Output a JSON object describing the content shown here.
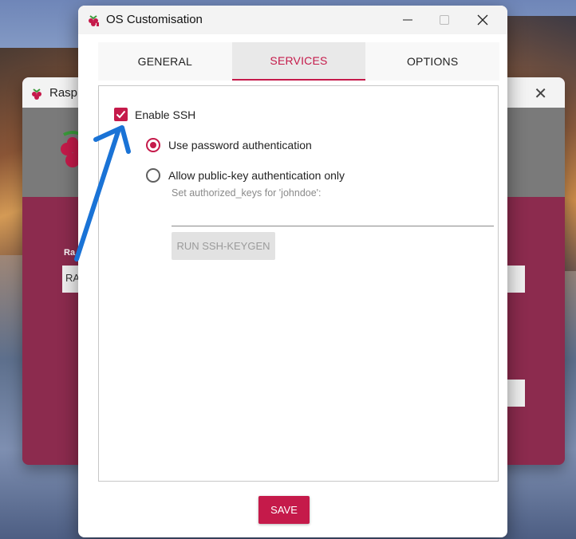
{
  "background_window": {
    "title": "Raspb",
    "field_text": "RA",
    "label_text": "Ra"
  },
  "dialog": {
    "title": "OS Customisation",
    "tabs": [
      {
        "label": "GENERAL",
        "active": false
      },
      {
        "label": "SERVICES",
        "active": true
      },
      {
        "label": "OPTIONS",
        "active": false
      }
    ],
    "services": {
      "enable_ssh_label": "Enable SSH",
      "enable_ssh_checked": true,
      "auth_options": [
        {
          "label": "Use password authentication",
          "selected": true
        },
        {
          "label": "Allow public-key authentication only",
          "selected": false
        }
      ],
      "authorized_keys_label": "Set authorized_keys for 'johndoe':",
      "authorized_keys_value": "",
      "keygen_button_label": "RUN SSH-KEYGEN"
    },
    "save_label": "SAVE"
  },
  "colors": {
    "accent": "#c51a4a",
    "annotation_arrow": "#1a73d6"
  },
  "icons": {
    "app_icon": "raspberry-icon",
    "minimize": "minimize-icon",
    "maximize": "maximize-icon",
    "close": "close-icon",
    "check": "check-icon"
  }
}
